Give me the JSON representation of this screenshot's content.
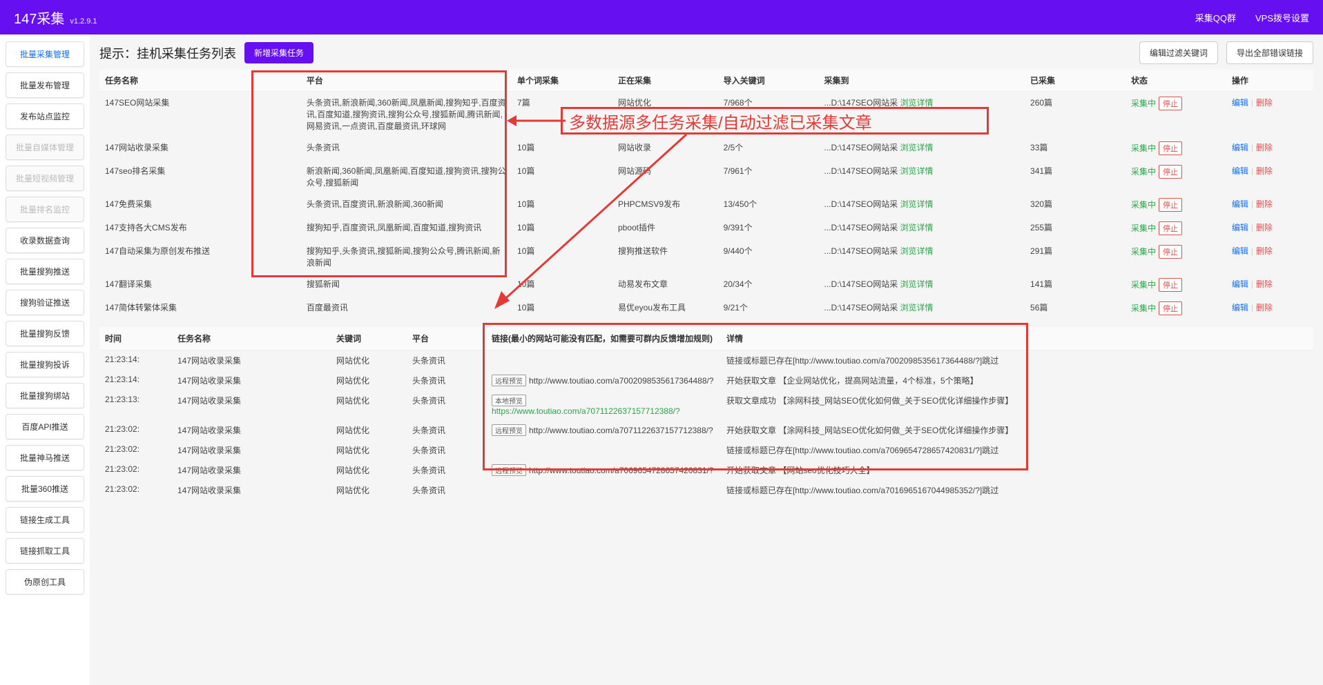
{
  "header": {
    "title": "147采集",
    "version": "v1.2.9.1",
    "links": [
      "采集QQ群",
      "VPS拨号设置"
    ]
  },
  "sidebar": {
    "items": [
      {
        "label": "批量采集管理",
        "state": "active"
      },
      {
        "label": "批量发布管理",
        "state": ""
      },
      {
        "label": "发布站点监控",
        "state": ""
      },
      {
        "label": "批量自媒体管理",
        "state": "disabled"
      },
      {
        "label": "批量短视频管理",
        "state": "disabled"
      },
      {
        "label": "批量排名监控",
        "state": "disabled"
      },
      {
        "label": "收录数据查询",
        "state": ""
      },
      {
        "label": "批量搜狗推送",
        "state": ""
      },
      {
        "label": "搜狗验证推送",
        "state": ""
      },
      {
        "label": "批量搜狗反馈",
        "state": ""
      },
      {
        "label": "批量搜狗投诉",
        "state": ""
      },
      {
        "label": "批量搜狗绑站",
        "state": ""
      },
      {
        "label": "百度API推送",
        "state": ""
      },
      {
        "label": "批量神马推送",
        "state": ""
      },
      {
        "label": "批量360推送",
        "state": ""
      },
      {
        "label": "链接生成工具",
        "state": ""
      },
      {
        "label": "链接抓取工具",
        "state": ""
      },
      {
        "label": "伪原创工具",
        "state": ""
      }
    ]
  },
  "toolbar": {
    "title": "提示：挂机采集任务列表",
    "add_btn": "新增采集任务",
    "edit_filter": "编辑过滤关键词",
    "export_err": "导出全部错误链接"
  },
  "tasks": {
    "headers": [
      "任务名称",
      "平台",
      "单个词采集",
      "正在采集",
      "导入关键词",
      "采集到",
      "已采集",
      "状态",
      "操作"
    ],
    "status_label": "采集中",
    "stop_label": "停止",
    "browse_label": "浏览详情",
    "edit_label": "编辑",
    "delete_label": "删除",
    "rows": [
      {
        "name": "147SEO网站采集",
        "platform": "头条资讯,新浪新闻,360新闻,凤凰新闻,搜狗知乎,百度资讯,百度知道,搜狗资讯,搜狗公众号,搜狐新闻,腾讯新闻,网易资讯,一点资讯,百度最资讯,环球网",
        "single": "7篇",
        "collecting": "网站优化",
        "imported": "7/968个",
        "dest": "...D:\\147SEO网站采",
        "collected": "260篇"
      },
      {
        "name": "147网站收录采集",
        "platform": "头条资讯",
        "single": "10篇",
        "collecting": "网站收录",
        "imported": "2/5个",
        "dest": "...D:\\147SEO网站采",
        "collected": "33篇"
      },
      {
        "name": "147seo排名采集",
        "platform": "新浪新闻,360新闻,凤凰新闻,百度知道,搜狗资讯,搜狗公众号,搜狐新闻",
        "single": "10篇",
        "collecting": "网站源码",
        "imported": "7/961个",
        "dest": "...D:\\147SEO网站采",
        "collected": "341篇"
      },
      {
        "name": "147免费采集",
        "platform": "头条资讯,百度资讯,新浪新闻,360新闻",
        "single": "10篇",
        "collecting": "PHPCMSV9发布",
        "imported": "13/450个",
        "dest": "...D:\\147SEO网站采",
        "collected": "320篇"
      },
      {
        "name": "147支持各大CMS发布",
        "platform": "搜狗知乎,百度资讯,凤凰新闻,百度知道,搜狗资讯",
        "single": "10篇",
        "collecting": "pboot插件",
        "imported": "9/391个",
        "dest": "...D:\\147SEO网站采",
        "collected": "255篇"
      },
      {
        "name": "147自动采集为原创发布推送",
        "platform": "搜狗知乎,头条资讯,搜狐新闻,搜狗公众号,腾讯新闻,新浪新闻",
        "single": "10篇",
        "collecting": "搜狗推送软件",
        "imported": "9/440个",
        "dest": "...D:\\147SEO网站采",
        "collected": "291篇"
      },
      {
        "name": "147翻译采集",
        "platform": "搜狐新闻",
        "single": "10篇",
        "collecting": "动易发布文章",
        "imported": "20/34个",
        "dest": "...D:\\147SEO网站采",
        "collected": "141篇"
      },
      {
        "name": "147简体转繁体采集",
        "platform": "百度最资讯",
        "single": "10篇",
        "collecting": "易优eyou发布工具",
        "imported": "9/21个",
        "dest": "...D:\\147SEO网站采",
        "collected": "56篇"
      }
    ]
  },
  "log": {
    "headers": [
      "时间",
      "任务名称",
      "关键词",
      "平台",
      "链接(最小的网站可能没有匹配，如需要可群内反馈增加规则)",
      "详情"
    ],
    "remote_tag": "远程预览",
    "local_tag": "本地预览",
    "rows": [
      {
        "time": "21:23:14:",
        "name": "147网站收录采集",
        "kw": "网站优化",
        "plat": "头条资讯",
        "link_type": "",
        "link": "",
        "detail": "链接或标题已存在[http://www.toutiao.com/a7002098535617364488/?]跳过"
      },
      {
        "time": "21:23:14:",
        "name": "147网站收录采集",
        "kw": "网站优化",
        "plat": "头条资讯",
        "link_type": "remote",
        "link": "http://www.toutiao.com/a7002098535617364488/?",
        "detail": "开始获取文章 【企业网站优化，提高网站流量，4个标准，5个策略】"
      },
      {
        "time": "21:23:13:",
        "name": "147网站收录采集",
        "kw": "网站优化",
        "plat": "头条资讯",
        "link_type": "local",
        "link": "https://www.toutiao.com/a7071122637157712388/?",
        "detail": "获取文章成功 【涂网科技_网站SEO优化如何做_关于SEO优化详细操作步骤】"
      },
      {
        "time": "21:23:02:",
        "name": "147网站收录采集",
        "kw": "网站优化",
        "plat": "头条资讯",
        "link_type": "remote",
        "link": "http://www.toutiao.com/a7071122637157712388/?",
        "detail": "开始获取文章 【涂网科技_网站SEO优化如何做_关于SEO优化详细操作步骤】"
      },
      {
        "time": "21:23:02:",
        "name": "147网站收录采集",
        "kw": "网站优化",
        "plat": "头条资讯",
        "link_type": "",
        "link": "",
        "detail": "链接或标题已存在[http://www.toutiao.com/a7069654728657420831/?]跳过"
      },
      {
        "time": "21:23:02:",
        "name": "147网站收录采集",
        "kw": "网站优化",
        "plat": "头条资讯",
        "link_type": "remote",
        "link": "http://www.toutiao.com/a7069654728657420831/?",
        "detail": "开始获取文章 【网站seo优化技巧大全】"
      },
      {
        "time": "21:23:02:",
        "name": "147网站收录采集",
        "kw": "网站优化",
        "plat": "头条资讯",
        "link_type": "",
        "link": "",
        "detail": "链接或标题已存在[http://www.toutiao.com/a7016965167044985352/?]跳过"
      }
    ]
  },
  "annotation": {
    "text": "多数据源多任务采集/自动过滤已采集文章"
  }
}
